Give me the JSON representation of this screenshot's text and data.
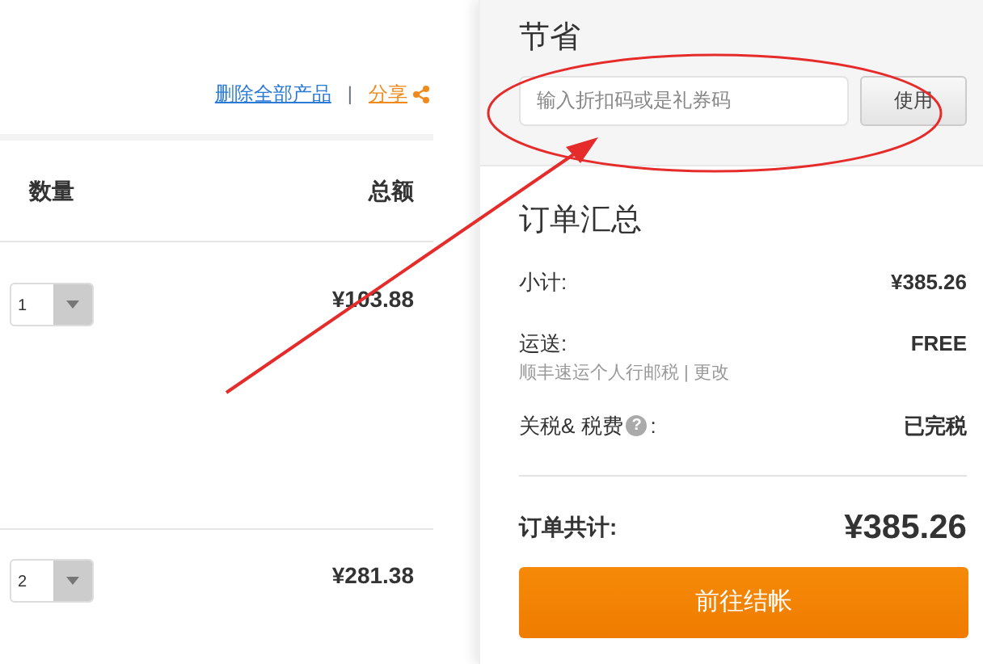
{
  "header_links": {
    "delete_all": "删除全部产品",
    "separator": "|",
    "share": "分享"
  },
  "table": {
    "columns": [
      "数量",
      "总额"
    ],
    "rows": [
      {
        "quantity": "1",
        "total": "¥103.88"
      },
      {
        "quantity": "2",
        "total": "¥281.38"
      }
    ]
  },
  "coupon": {
    "title": "节省",
    "placeholder": "输入折扣码或是礼券码",
    "button": "使用"
  },
  "summary": {
    "title": "订单汇总",
    "lines": [
      {
        "label": "小计:",
        "value": "¥385.26"
      },
      {
        "label": "运送:",
        "value": "FREE",
        "note": "顺丰速运个人行邮税 |",
        "link": "更改"
      },
      {
        "label": "关税& 税费",
        "help": "?",
        "suffix": ":",
        "value": "已完税"
      }
    ],
    "total_label": "订单共计:",
    "total_value": "¥385.26",
    "checkout": "前往结帐"
  }
}
